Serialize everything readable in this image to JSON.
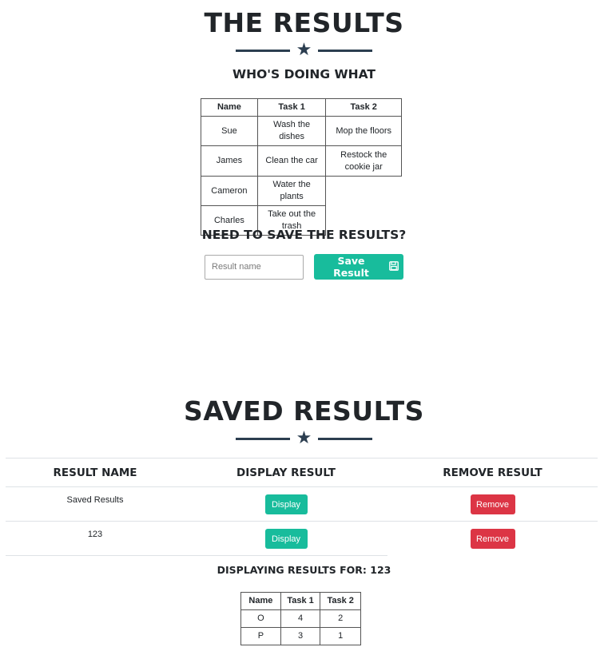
{
  "results_section": {
    "title": "THE RESULTS",
    "subtitle": "WHO'S DOING WHAT",
    "star_icon": "star-icon",
    "table": {
      "headers": [
        "Name",
        "Task 1",
        "Task 2"
      ],
      "rows": [
        [
          "Sue",
          "Wash the dishes",
          "Mop the floors"
        ],
        [
          "James",
          "Clean the car",
          "Restock the cookie jar"
        ],
        [
          "Cameron",
          "Water the plants",
          ""
        ],
        [
          "Charles",
          "Take out the trash",
          ""
        ]
      ]
    },
    "save_prompt": "NEED TO SAVE THE RESULTS?",
    "result_name_placeholder": "Result name",
    "save_button_label": "Save Result",
    "save_icon": "floppy-disk-icon"
  },
  "saved_section": {
    "title": "SAVED RESULTS",
    "columns": [
      "RESULT NAME",
      "DISPLAY RESULT",
      "REMOVE RESULT"
    ],
    "rows": [
      {
        "name": "Saved Results",
        "display_label": "Display",
        "remove_label": "Remove"
      },
      {
        "name": "123",
        "display_label": "Display",
        "remove_label": "Remove"
      }
    ],
    "displaying_heading": "DISPLAYING RESULTS FOR: 123",
    "display_table": {
      "headers": [
        "Name",
        "Task 1",
        "Task 2"
      ],
      "rows": [
        [
          "O",
          "4",
          "2"
        ],
        [
          "P",
          "3",
          "1"
        ]
      ]
    }
  },
  "colors": {
    "accent_teal": "#18bc9c",
    "danger_red": "#dc3545",
    "divider_navy": "#2c3e50"
  }
}
